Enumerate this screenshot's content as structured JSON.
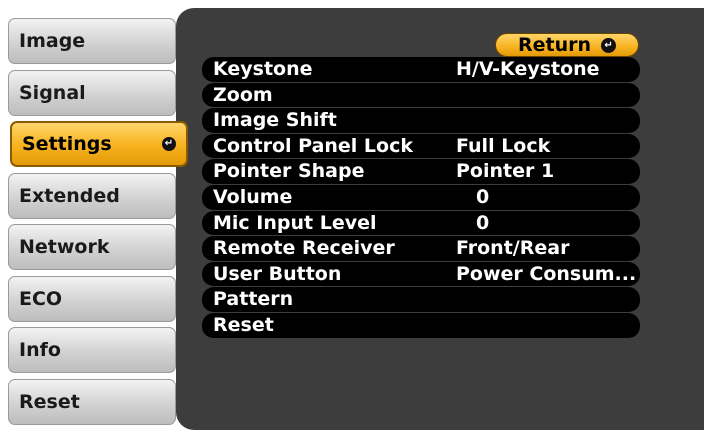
{
  "menu": {
    "tabs": [
      {
        "label": "Image"
      },
      {
        "label": "Signal"
      },
      {
        "label": "Settings",
        "active": true
      },
      {
        "label": "Extended"
      },
      {
        "label": "Network"
      },
      {
        "label": "ECO"
      },
      {
        "label": "Info"
      },
      {
        "label": "Reset"
      }
    ],
    "enter_icon": "enter-icon"
  },
  "panel": {
    "return_label": "Return",
    "rows": [
      {
        "label": "Keystone",
        "value": "H/V-Keystone"
      },
      {
        "label": "Zoom",
        "value": ""
      },
      {
        "label": "Image Shift",
        "value": ""
      },
      {
        "label": "Control Panel Lock",
        "value": "Full Lock"
      },
      {
        "label": "Pointer Shape",
        "value": "Pointer 1"
      },
      {
        "label": "Volume",
        "value": "0"
      },
      {
        "label": "Mic Input Level",
        "value": "0"
      },
      {
        "label": "Remote Receiver",
        "value": "Front/Rear"
      },
      {
        "label": "User Button",
        "value": "Power Consum..."
      },
      {
        "label": "Pattern",
        "value": ""
      },
      {
        "label": "Reset",
        "value": ""
      }
    ]
  },
  "colors": {
    "panel_bg": "#3d3d3d",
    "row_bg": "#000000",
    "active_accent": "#f7b21e",
    "tab_bg": "#d2d2d2"
  }
}
